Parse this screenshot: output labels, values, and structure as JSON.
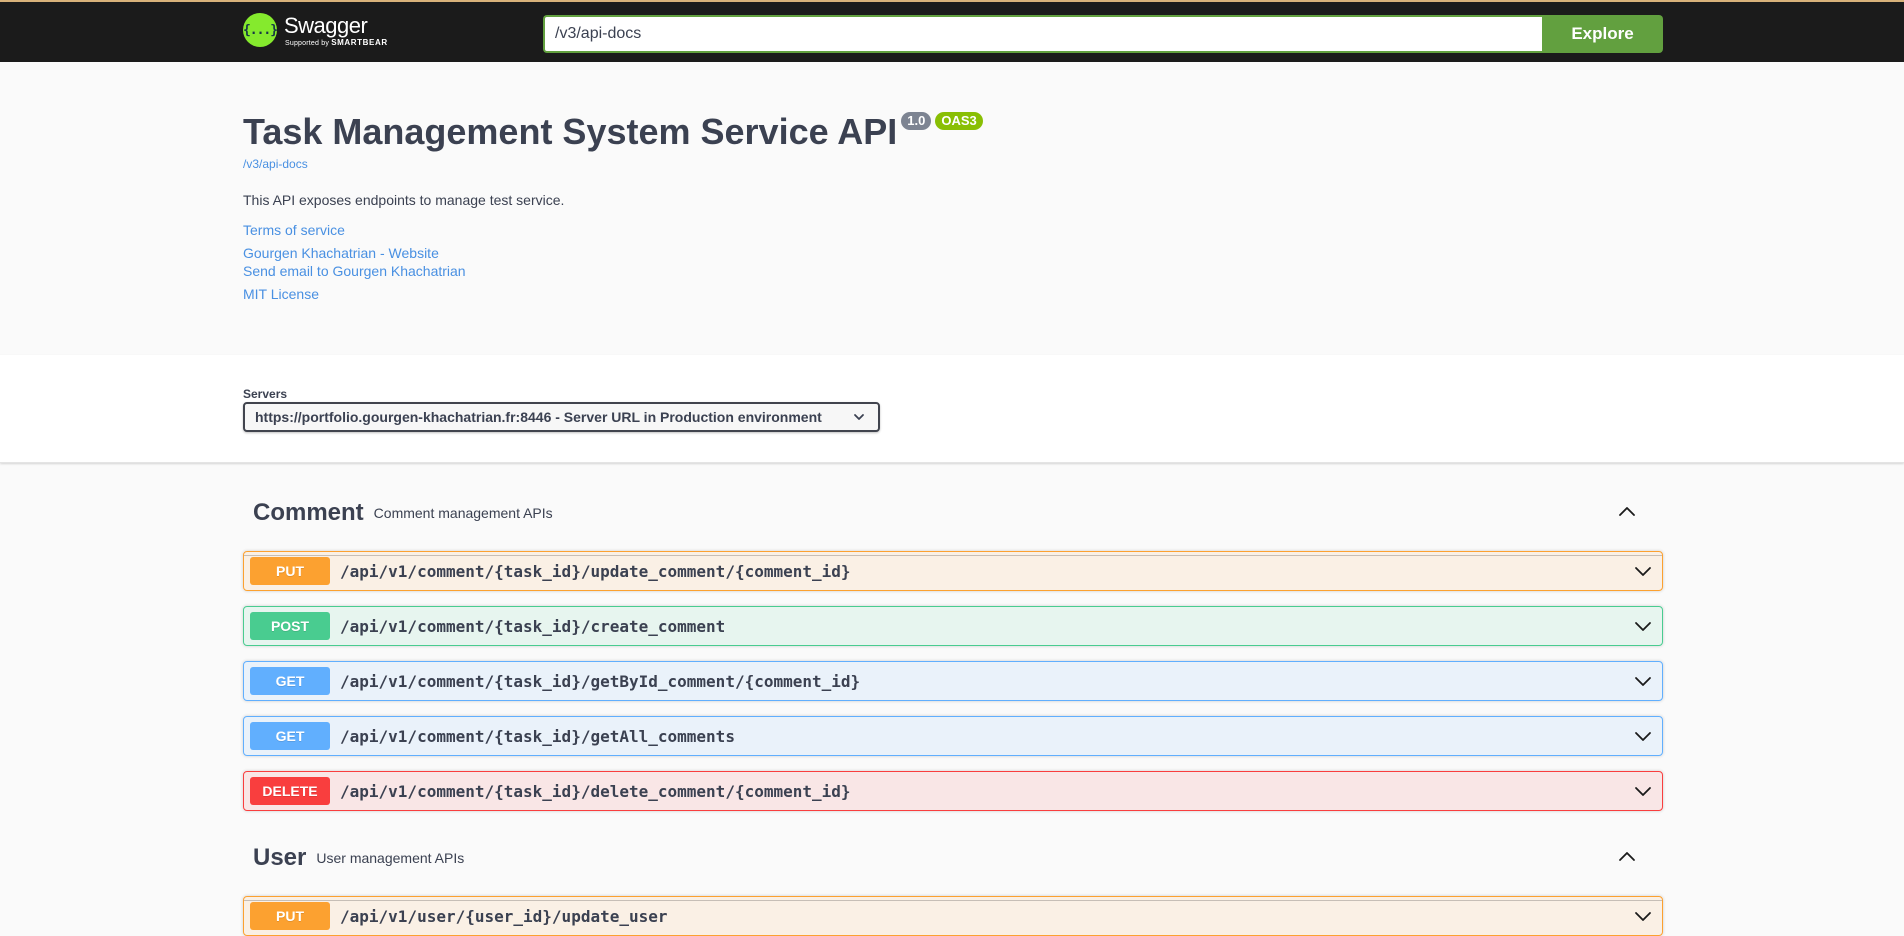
{
  "topbar": {
    "logo_title": "Swagger",
    "logo_supported": "Supported by",
    "logo_brand": "SMARTBEAR",
    "logo_mark": "{...}",
    "url_value": "/v3/api-docs",
    "explore_label": "Explore",
    "accent_color": "#62a03f",
    "logo_color": "#85ea2d"
  },
  "info": {
    "title": "Task Management System Service API",
    "version_badge": "1.0",
    "oas_badge": "OAS3",
    "spec_link": "/v3/api-docs",
    "description": "This API exposes endpoints to manage test service.",
    "terms_link": "Terms of service",
    "contact_website": "Gourgen Khachatrian - Website",
    "contact_email": "Send email to Gourgen Khachatrian",
    "license_link": "MIT License"
  },
  "servers": {
    "label": "Servers",
    "selected": "https://portfolio.gourgen-khachatrian.fr:8446 - Server URL in Production environment"
  },
  "tags": [
    {
      "name": "Comment",
      "description": "Comment management APIs",
      "operations": [
        {
          "method": "PUT",
          "path": "/api/v1/comment/{task_id}/update_comment/{comment_id}"
        },
        {
          "method": "POST",
          "path": "/api/v1/comment/{task_id}/create_comment"
        },
        {
          "method": "GET",
          "path": "/api/v1/comment/{task_id}/getById_comment/{comment_id}"
        },
        {
          "method": "GET",
          "path": "/api/v1/comment/{task_id}/getAll_comments"
        },
        {
          "method": "DELETE",
          "path": "/api/v1/comment/{task_id}/delete_comment/{comment_id}"
        }
      ]
    },
    {
      "name": "User",
      "description": "User management APIs",
      "operations": [
        {
          "method": "PUT",
          "path": "/api/v1/user/{user_id}/update_user"
        }
      ]
    }
  ],
  "method_colors": {
    "PUT": "#fca130",
    "POST": "#49cc90",
    "GET": "#61affe",
    "DELETE": "#f93e3e"
  }
}
